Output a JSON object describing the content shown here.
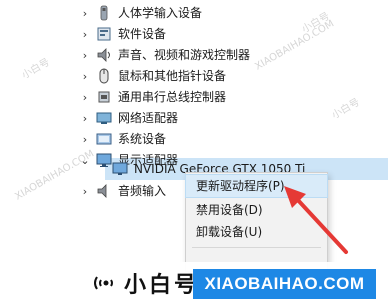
{
  "tree": {
    "items": [
      {
        "label": "人体学输入设备",
        "icon": "hid-icon",
        "expanded": false
      },
      {
        "label": "软件设备",
        "icon": "software-device-icon",
        "expanded": false
      },
      {
        "label": "声音、视频和游戏控制器",
        "icon": "sound-icon",
        "expanded": false
      },
      {
        "label": "鼠标和其他指针设备",
        "icon": "mouse-icon",
        "expanded": false
      },
      {
        "label": "通用串行总线控制器",
        "icon": "usb-icon",
        "expanded": false
      },
      {
        "label": "网络适配器",
        "icon": "network-adapter-icon",
        "expanded": false
      },
      {
        "label": "系统设备",
        "icon": "system-device-icon",
        "expanded": false
      },
      {
        "label": "显示适配器",
        "icon": "display-adapter-icon",
        "expanded": true
      },
      {
        "label": "NVIDIA GeForce GTX 1050 Ti",
        "icon": "gpu-icon",
        "selected": true
      },
      {
        "label": "音频输入",
        "icon": "audio-input-icon",
        "expanded": false
      }
    ]
  },
  "context_menu": {
    "items": [
      {
        "label": "更新驱动程序(P)",
        "highlighted": true
      },
      {
        "label": "禁用设备(D)"
      },
      {
        "label": "卸载设备(U)"
      }
    ]
  },
  "watermark": {
    "brand_zh": "小白号",
    "brand_en": "XIAOBAIHAO.COM",
    "brand_color": "#1e88e5",
    "tile_zh": "小白号",
    "tile_en": "XIAOBAIHAO.COM"
  },
  "colors": {
    "selection": "#cce4f7",
    "menu_highlight": "#d9ebf9",
    "arrow": "#e53935"
  }
}
